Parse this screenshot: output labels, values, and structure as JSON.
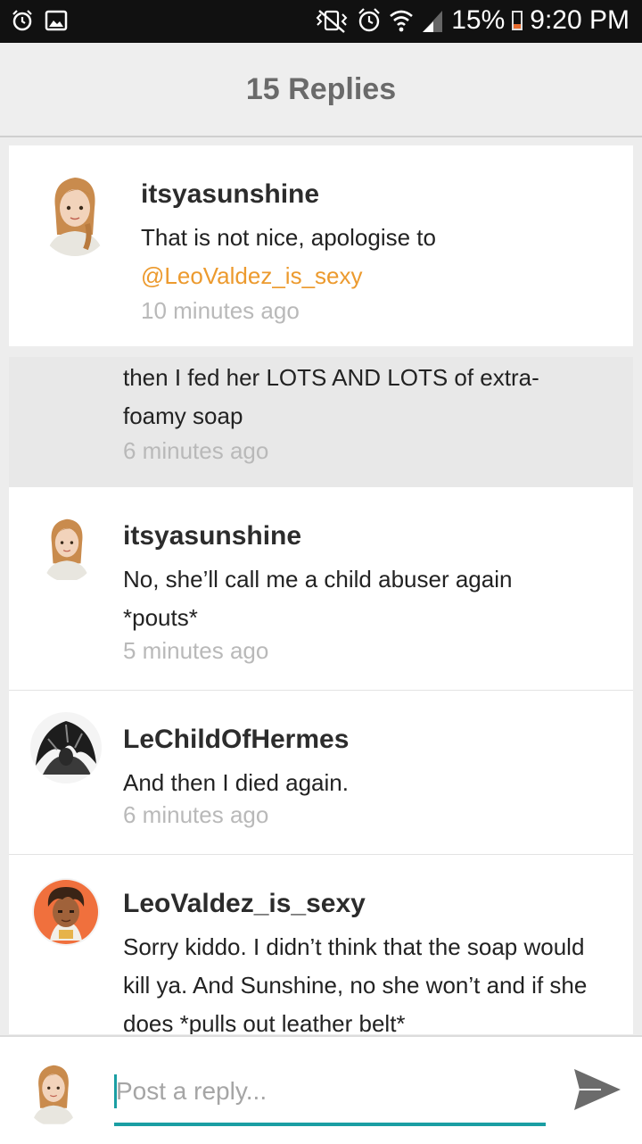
{
  "status_bar": {
    "battery": "15%",
    "time": "9:20 PM",
    "left_icons": [
      "alarm-icon",
      "image-icon"
    ],
    "right_icons": [
      "vibrate-icon",
      "alarm-icon",
      "wifi-icon",
      "signal-icon",
      "battery-icon"
    ]
  },
  "header": {
    "title": "15 Replies"
  },
  "replies": [
    {
      "username": "itsyasunshine",
      "text": "That is not nice, apologise to",
      "mention": "@LeoValdez_is_sexy",
      "time": "10 minutes ago"
    },
    {
      "username": "",
      "text": "then I fed her LOTS AND LOTS of extra-foamy soap",
      "time": "6 minutes ago"
    },
    {
      "username": "itsyasunshine",
      "text": "No, she’ll call me a child abuser again *pouts*",
      "time": "5 minutes ago"
    },
    {
      "username": "LeChildOfHermes",
      "text": "And then I died again.",
      "time": "6 minutes ago"
    },
    {
      "username": "LeoValdez_is_sexy",
      "text": "Sorry kiddo. I didn’t think that the soap would kill ya. And Sunshine, no she won’t and if she does *pulls out leather belt*",
      "time": ""
    }
  ],
  "composer": {
    "placeholder": "Post a reply..."
  },
  "colors": {
    "accent": "#1a9ea3",
    "mention": "#ec9a2e",
    "status_bar": "#111111"
  }
}
